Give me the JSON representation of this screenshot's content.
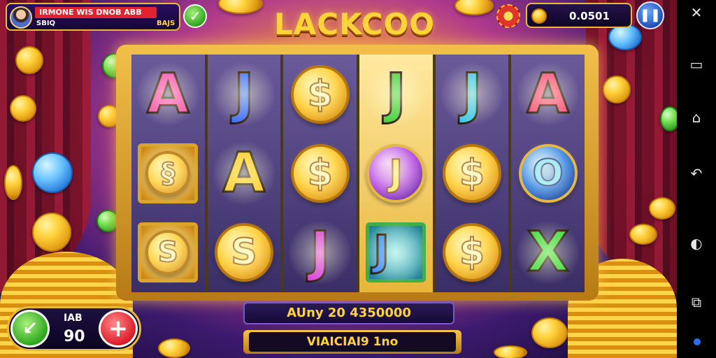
{
  "hud": {
    "player_name": "IRMONE WIS DNOB ABB",
    "player_sub": "SBIQ",
    "player_sub_right": "BAJS",
    "game_title": "LACKCOO",
    "balance": "0.0501"
  },
  "reels": [
    [
      {
        "kind": "letter",
        "text": "A",
        "color": "#ff4ab0"
      },
      {
        "kind": "square",
        "text": "§",
        "style": "gold"
      },
      {
        "kind": "square",
        "text": "S",
        "style": "gold"
      }
    ],
    [
      {
        "kind": "letter",
        "text": "J",
        "color": "#3a6cff"
      },
      {
        "kind": "letter",
        "text": "A",
        "color": "#ffcc1e"
      },
      {
        "kind": "coin",
        "text": "S",
        "style": "gold"
      }
    ],
    [
      {
        "kind": "coin",
        "text": "$",
        "style": "gold"
      },
      {
        "kind": "coin",
        "text": "$",
        "style": "gold"
      },
      {
        "kind": "letter",
        "text": "J",
        "color": "#d83cd8"
      }
    ],
    [
      {
        "kind": "letter",
        "text": "J",
        "color": "#3fcf3a"
      },
      {
        "kind": "coin",
        "text": "J",
        "style": "purple"
      },
      {
        "kind": "square",
        "text": "J",
        "style": "teal"
      }
    ],
    [
      {
        "kind": "letter",
        "text": "J",
        "color": "#38c8e8"
      },
      {
        "kind": "coin",
        "text": "$",
        "style": "gold"
      },
      {
        "kind": "coin",
        "text": "$",
        "style": "gold"
      }
    ],
    [
      {
        "kind": "letter",
        "text": "A",
        "color": "#ff4a7a"
      },
      {
        "kind": "coin",
        "text": "O",
        "style": "blue"
      },
      {
        "kind": "letter",
        "text": "X",
        "color": "#3ad83a"
      }
    ]
  ],
  "bottom": {
    "win_text": "AUny 20 4350000",
    "bet_text": "VIAICIAI9 1no"
  },
  "bet_control": {
    "minus_label": "↙",
    "label": "IAB",
    "value": "90",
    "plus_label": "+"
  },
  "nav": {
    "close": "✕",
    "recent": "▭",
    "home": "⌂",
    "back": "↶",
    "assist": "◐",
    "screen": "⧉"
  },
  "colors": {
    "gold": "#ffd43a",
    "frame": "#e8b93a",
    "accent_red": "#e0232f",
    "accent_green": "#2ea71e",
    "accent_blue": "#1f4fb8"
  },
  "icons": [
    "avatar-icon",
    "check-icon",
    "gear-icon",
    "coin-icon",
    "pause-icon",
    "close-icon",
    "recent-apps-icon",
    "home-icon",
    "back-icon",
    "assistant-icon",
    "screenshot-icon"
  ]
}
